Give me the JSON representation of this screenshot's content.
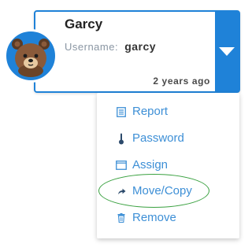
{
  "user": {
    "name": "Garcy",
    "username_label": "Username:",
    "username_value": "garcy",
    "timestamp": "2 years ago",
    "avatar_icon": "bear-icon"
  },
  "menu": {
    "items": [
      {
        "label": "Report",
        "icon": "report-icon"
      },
      {
        "label": "Password",
        "icon": "thermometer-icon"
      },
      {
        "label": "Assign",
        "icon": "window-icon"
      },
      {
        "label": "Move/Copy",
        "icon": "share-arrow-icon",
        "highlighted": true
      },
      {
        "label": "Remove",
        "icon": "trash-icon"
      }
    ]
  },
  "colors": {
    "accent": "#1f82d8",
    "menu_text": "#3d8fd6",
    "highlight": "#3aa140"
  }
}
